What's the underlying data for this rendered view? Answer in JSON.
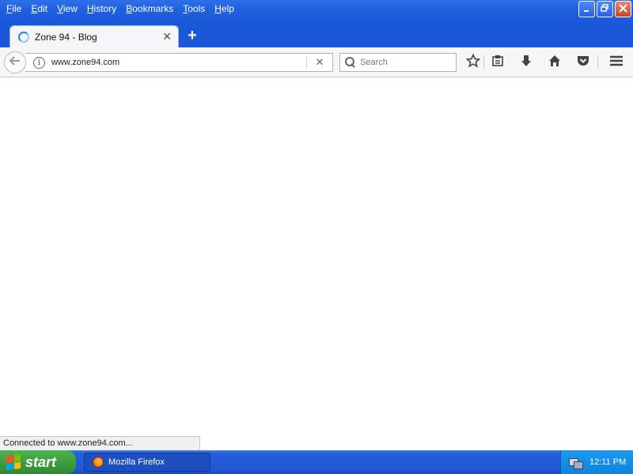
{
  "menu": [
    "File",
    "Edit",
    "View",
    "History",
    "Bookmarks",
    "Tools",
    "Help"
  ],
  "window_controls": {
    "minimize_icon": "minimize-icon",
    "restore_icon": "restore-icon",
    "close_icon": "close-icon"
  },
  "tab": {
    "title": "Zone 94 - Blog",
    "close_glyph": "✕",
    "loading": true
  },
  "new_tab_glyph": "+",
  "nav": {
    "url": "www.zone94.com",
    "stop_glyph": "✕",
    "search_placeholder": "Search"
  },
  "status_text": "Connected to www.zone94.com...",
  "taskbar": {
    "start_label": "start",
    "task_label": "Mozilla Firefox",
    "clock": "12:11 PM"
  },
  "colors": {
    "titlebar": "#1e5fe0",
    "taskbar": "#2157d3",
    "start": "#3c9e3c",
    "tray": "#0f83de"
  }
}
